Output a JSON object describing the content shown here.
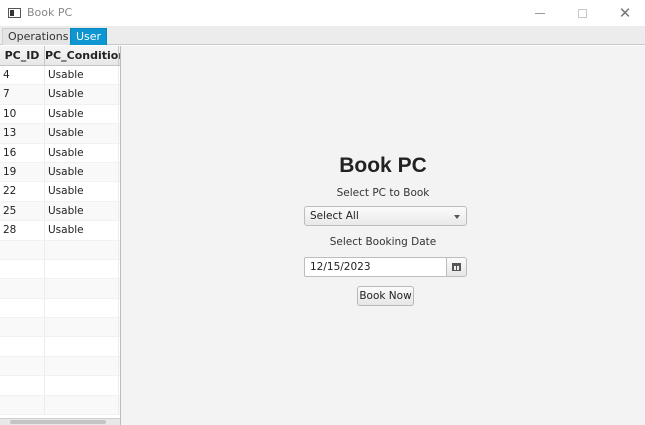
{
  "window": {
    "title": "Book PC",
    "controls": {
      "minimize": "minimize",
      "maximize": "maximize",
      "close": "✕"
    }
  },
  "tabs": [
    {
      "label": "Operations",
      "active": false
    },
    {
      "label": "User",
      "active": true
    }
  ],
  "table": {
    "columns": [
      "PC_ID",
      "PC_Condition"
    ],
    "rows": [
      [
        "4",
        "Usable"
      ],
      [
        "7",
        "Usable"
      ],
      [
        "10",
        "Usable"
      ],
      [
        "13",
        "Usable"
      ],
      [
        "16",
        "Usable"
      ],
      [
        "19",
        "Usable"
      ],
      [
        "22",
        "Usable"
      ],
      [
        "25",
        "Usable"
      ],
      [
        "28",
        "Usable"
      ]
    ],
    "empty_rows": 9
  },
  "form": {
    "title": "Book PC",
    "select_pc_label": "Select PC to Book",
    "select_pc_value": "Select All",
    "date_label": "Select Booking Date",
    "date_value": "12/15/2023",
    "submit_label": "Book Now"
  },
  "icons": {
    "app": "window-icon",
    "calendar": "calendar-icon",
    "dropdown": "chevron-down-icon"
  },
  "colors": {
    "active_tab": "#0d96d1",
    "panel_bg": "#f3f3f3"
  }
}
